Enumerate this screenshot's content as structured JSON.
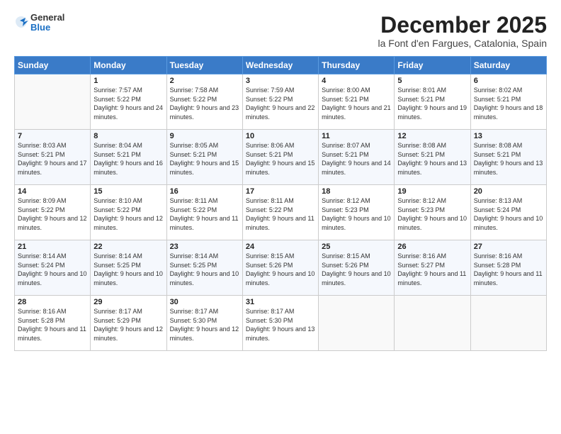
{
  "header": {
    "logo_general": "General",
    "logo_blue": "Blue",
    "month_title": "December 2025",
    "subtitle": "la Font d'en Fargues, Catalonia, Spain"
  },
  "days_of_week": [
    "Sunday",
    "Monday",
    "Tuesday",
    "Wednesday",
    "Thursday",
    "Friday",
    "Saturday"
  ],
  "weeks": [
    [
      {
        "day": "",
        "sunrise": "",
        "sunset": "",
        "daylight": ""
      },
      {
        "day": "1",
        "sunrise": "Sunrise: 7:57 AM",
        "sunset": "Sunset: 5:22 PM",
        "daylight": "Daylight: 9 hours and 24 minutes."
      },
      {
        "day": "2",
        "sunrise": "Sunrise: 7:58 AM",
        "sunset": "Sunset: 5:22 PM",
        "daylight": "Daylight: 9 hours and 23 minutes."
      },
      {
        "day": "3",
        "sunrise": "Sunrise: 7:59 AM",
        "sunset": "Sunset: 5:22 PM",
        "daylight": "Daylight: 9 hours and 22 minutes."
      },
      {
        "day": "4",
        "sunrise": "Sunrise: 8:00 AM",
        "sunset": "Sunset: 5:21 PM",
        "daylight": "Daylight: 9 hours and 21 minutes."
      },
      {
        "day": "5",
        "sunrise": "Sunrise: 8:01 AM",
        "sunset": "Sunset: 5:21 PM",
        "daylight": "Daylight: 9 hours and 19 minutes."
      },
      {
        "day": "6",
        "sunrise": "Sunrise: 8:02 AM",
        "sunset": "Sunset: 5:21 PM",
        "daylight": "Daylight: 9 hours and 18 minutes."
      }
    ],
    [
      {
        "day": "7",
        "sunrise": "Sunrise: 8:03 AM",
        "sunset": "Sunset: 5:21 PM",
        "daylight": "Daylight: 9 hours and 17 minutes."
      },
      {
        "day": "8",
        "sunrise": "Sunrise: 8:04 AM",
        "sunset": "Sunset: 5:21 PM",
        "daylight": "Daylight: 9 hours and 16 minutes."
      },
      {
        "day": "9",
        "sunrise": "Sunrise: 8:05 AM",
        "sunset": "Sunset: 5:21 PM",
        "daylight": "Daylight: 9 hours and 15 minutes."
      },
      {
        "day": "10",
        "sunrise": "Sunrise: 8:06 AM",
        "sunset": "Sunset: 5:21 PM",
        "daylight": "Daylight: 9 hours and 15 minutes."
      },
      {
        "day": "11",
        "sunrise": "Sunrise: 8:07 AM",
        "sunset": "Sunset: 5:21 PM",
        "daylight": "Daylight: 9 hours and 14 minutes."
      },
      {
        "day": "12",
        "sunrise": "Sunrise: 8:08 AM",
        "sunset": "Sunset: 5:21 PM",
        "daylight": "Daylight: 9 hours and 13 minutes."
      },
      {
        "day": "13",
        "sunrise": "Sunrise: 8:08 AM",
        "sunset": "Sunset: 5:21 PM",
        "daylight": "Daylight: 9 hours and 13 minutes."
      }
    ],
    [
      {
        "day": "14",
        "sunrise": "Sunrise: 8:09 AM",
        "sunset": "Sunset: 5:22 PM",
        "daylight": "Daylight: 9 hours and 12 minutes."
      },
      {
        "day": "15",
        "sunrise": "Sunrise: 8:10 AM",
        "sunset": "Sunset: 5:22 PM",
        "daylight": "Daylight: 9 hours and 12 minutes."
      },
      {
        "day": "16",
        "sunrise": "Sunrise: 8:11 AM",
        "sunset": "Sunset: 5:22 PM",
        "daylight": "Daylight: 9 hours and 11 minutes."
      },
      {
        "day": "17",
        "sunrise": "Sunrise: 8:11 AM",
        "sunset": "Sunset: 5:22 PM",
        "daylight": "Daylight: 9 hours and 11 minutes."
      },
      {
        "day": "18",
        "sunrise": "Sunrise: 8:12 AM",
        "sunset": "Sunset: 5:23 PM",
        "daylight": "Daylight: 9 hours and 10 minutes."
      },
      {
        "day": "19",
        "sunrise": "Sunrise: 8:12 AM",
        "sunset": "Sunset: 5:23 PM",
        "daylight": "Daylight: 9 hours and 10 minutes."
      },
      {
        "day": "20",
        "sunrise": "Sunrise: 8:13 AM",
        "sunset": "Sunset: 5:24 PM",
        "daylight": "Daylight: 9 hours and 10 minutes."
      }
    ],
    [
      {
        "day": "21",
        "sunrise": "Sunrise: 8:14 AM",
        "sunset": "Sunset: 5:24 PM",
        "daylight": "Daylight: 9 hours and 10 minutes."
      },
      {
        "day": "22",
        "sunrise": "Sunrise: 8:14 AM",
        "sunset": "Sunset: 5:25 PM",
        "daylight": "Daylight: 9 hours and 10 minutes."
      },
      {
        "day": "23",
        "sunrise": "Sunrise: 8:14 AM",
        "sunset": "Sunset: 5:25 PM",
        "daylight": "Daylight: 9 hours and 10 minutes."
      },
      {
        "day": "24",
        "sunrise": "Sunrise: 8:15 AM",
        "sunset": "Sunset: 5:26 PM",
        "daylight": "Daylight: 9 hours and 10 minutes."
      },
      {
        "day": "25",
        "sunrise": "Sunrise: 8:15 AM",
        "sunset": "Sunset: 5:26 PM",
        "daylight": "Daylight: 9 hours and 10 minutes."
      },
      {
        "day": "26",
        "sunrise": "Sunrise: 8:16 AM",
        "sunset": "Sunset: 5:27 PM",
        "daylight": "Daylight: 9 hours and 11 minutes."
      },
      {
        "day": "27",
        "sunrise": "Sunrise: 8:16 AM",
        "sunset": "Sunset: 5:28 PM",
        "daylight": "Daylight: 9 hours and 11 minutes."
      }
    ],
    [
      {
        "day": "28",
        "sunrise": "Sunrise: 8:16 AM",
        "sunset": "Sunset: 5:28 PM",
        "daylight": "Daylight: 9 hours and 11 minutes."
      },
      {
        "day": "29",
        "sunrise": "Sunrise: 8:17 AM",
        "sunset": "Sunset: 5:29 PM",
        "daylight": "Daylight: 9 hours and 12 minutes."
      },
      {
        "day": "30",
        "sunrise": "Sunrise: 8:17 AM",
        "sunset": "Sunset: 5:30 PM",
        "daylight": "Daylight: 9 hours and 12 minutes."
      },
      {
        "day": "31",
        "sunrise": "Sunrise: 8:17 AM",
        "sunset": "Sunset: 5:30 PM",
        "daylight": "Daylight: 9 hours and 13 minutes."
      },
      {
        "day": "",
        "sunrise": "",
        "sunset": "",
        "daylight": ""
      },
      {
        "day": "",
        "sunrise": "",
        "sunset": "",
        "daylight": ""
      },
      {
        "day": "",
        "sunrise": "",
        "sunset": "",
        "daylight": ""
      }
    ]
  ]
}
